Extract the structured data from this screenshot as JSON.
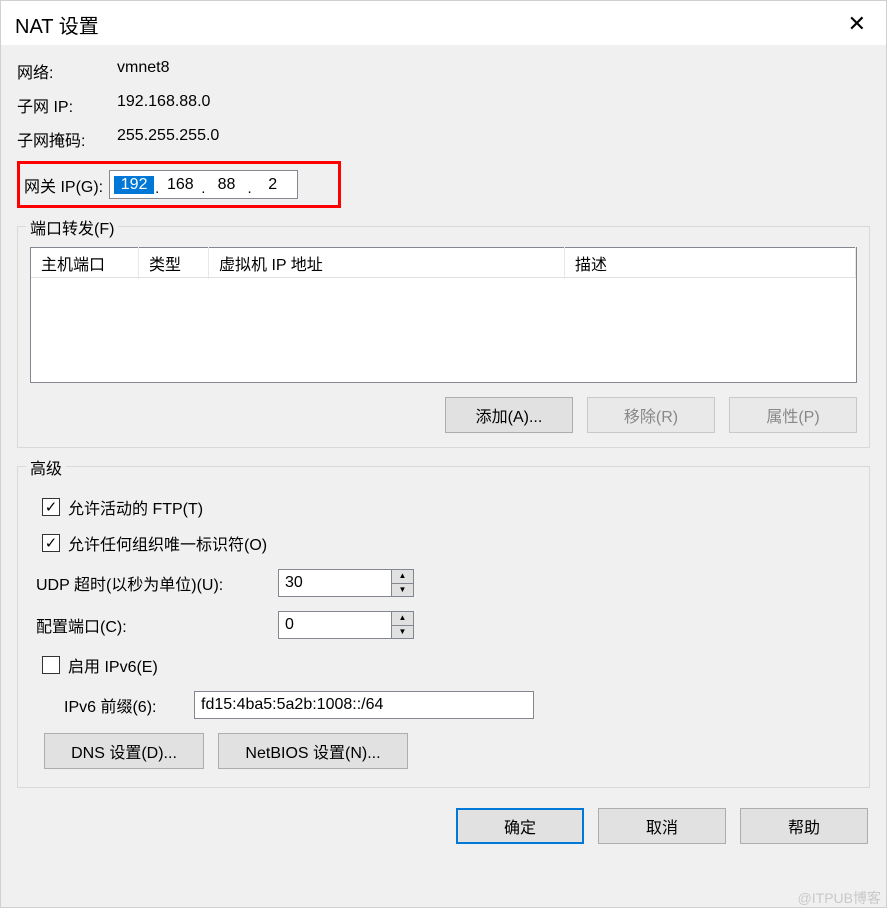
{
  "title": "NAT 设置",
  "info": {
    "network_label": "网络:",
    "network_value": "vmnet8",
    "subnet_ip_label": "子网 IP:",
    "subnet_ip_value": "192.168.88.0",
    "subnet_mask_label": "子网掩码:",
    "subnet_mask_value": "255.255.255.0"
  },
  "gateway": {
    "label": "网关 IP(G):",
    "seg1": "192",
    "seg2": "168",
    "seg3": "88",
    "seg4": "2"
  },
  "port_forward": {
    "title": "端口转发(F)",
    "col_host_port": "主机端口",
    "col_type": "类型",
    "col_vm_ip": "虚拟机 IP 地址",
    "col_desc": "描述",
    "add": "添加(A)...",
    "remove": "移除(R)",
    "props": "属性(P)"
  },
  "advanced": {
    "title": "高级",
    "ftp": "允许活动的 FTP(T)",
    "oui": "允许任何组织唯一标识符(O)",
    "udp_label": "UDP 超时(以秒为单位)(U):",
    "udp_value": "30",
    "config_port_label": "配置端口(C):",
    "config_port_value": "0",
    "ipv6_enable": "启用 IPv6(E)",
    "ipv6_prefix_label": "IPv6 前缀(6):",
    "ipv6_prefix_value": "fd15:4ba5:5a2b:1008::/64",
    "dns_btn": "DNS 设置(D)...",
    "netbios_btn": "NetBIOS 设置(N)..."
  },
  "buttons": {
    "ok": "确定",
    "cancel": "取消",
    "help": "帮助"
  },
  "watermark": "@ITPUB博客"
}
